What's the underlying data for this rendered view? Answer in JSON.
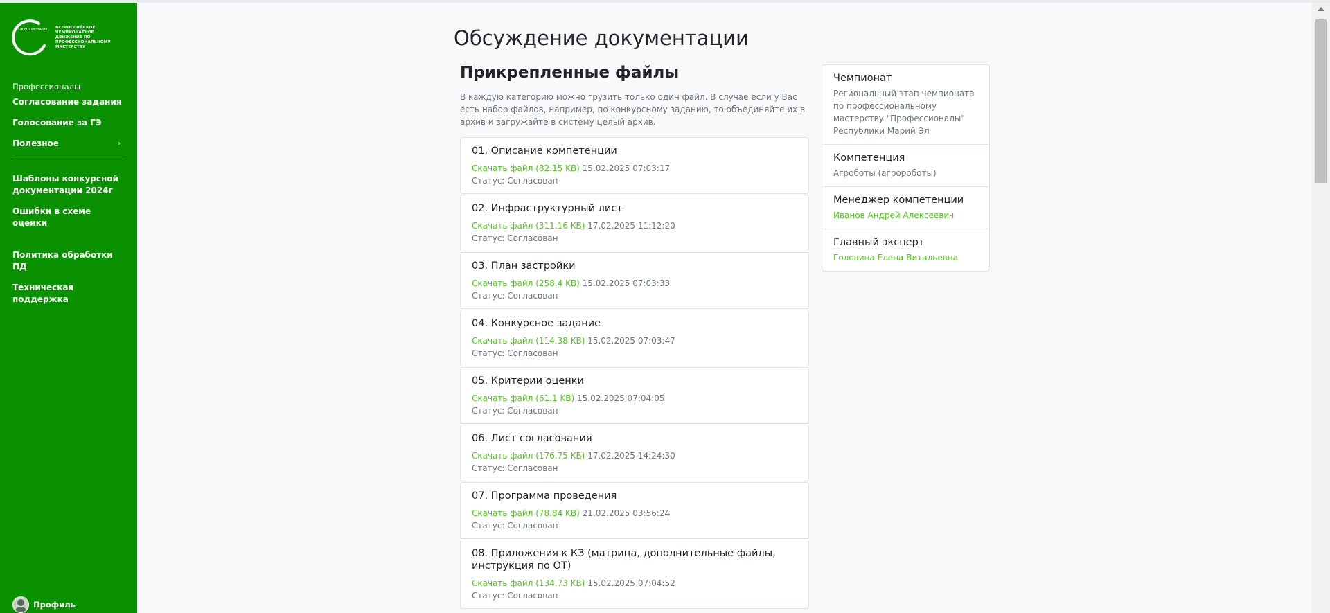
{
  "sidebar": {
    "logo_text": "Всероссийское чемпионатное движение по профессиональному мастерству",
    "logo_ring_text": "ПРОФЕССИОНАЛЫ",
    "section_label": "Профессионалы",
    "items_group1": [
      {
        "label": "Согласование задания"
      },
      {
        "label": "Голосование за ГЭ"
      },
      {
        "label": "Полезное"
      }
    ],
    "items_group2": [
      {
        "label": "Шаблоны конкурсной документации 2024г"
      },
      {
        "label": "Ошибки в схеме оценки"
      }
    ],
    "items_group3": [
      {
        "label": "Политика обработки ПД"
      },
      {
        "label": "Техническая поддержка"
      }
    ],
    "profile_label": "Профиль"
  },
  "main": {
    "page_title": "Обсуждение документации",
    "section_title": "Прикрепленные файлы",
    "hint": "В каждую категорию можно грузить только один файл. В случае если у Вас есть набор файлов, например, по конкурсному заданию, то объединяйте их в архив и загружайте в систему целый архив.",
    "files": [
      {
        "title": "01. Описание компетенции",
        "link": "Скачать файл (82.15 KB)",
        "date": "15.02.2025 07:03:17",
        "status": "Статус: Согласован"
      },
      {
        "title": "02. Инфраструктурный лист",
        "link": "Скачать файл (311.16 KB)",
        "date": "17.02.2025 11:12:20",
        "status": "Статус: Согласован"
      },
      {
        "title": "03. План застройки",
        "link": "Скачать файл (258.4 KB)",
        "date": "15.02.2025 07:03:33",
        "status": "Статус: Согласован"
      },
      {
        "title": "04. Конкурсное задание",
        "link": "Скачать файл (114.38 KB)",
        "date": "15.02.2025 07:03:47",
        "status": "Статус: Согласован"
      },
      {
        "title": "05. Критерии оценки",
        "link": "Скачать файл (61.1 KB)",
        "date": "15.02.2025 07:04:05",
        "status": "Статус: Согласован"
      },
      {
        "title": "06. Лист согласования",
        "link": "Скачать файл (176.75 KB)",
        "date": "17.02.2025 14:24:30",
        "status": "Статус: Согласован"
      },
      {
        "title": "07. Программа проведения",
        "link": "Скачать файл (78.84 KB)",
        "date": "21.02.2025 03:56:24",
        "status": "Статус: Согласован"
      },
      {
        "title": "08. Приложения к КЗ (матрица, дополнительные файлы, инструкция по ОТ)",
        "link": "Скачать файл (134.73 KB)",
        "date": "15.02.2025 07:04:52",
        "status": "Статус: Согласован"
      }
    ]
  },
  "info": {
    "championship_label": "Чемпионат",
    "championship_value": "Региональный этап чемпионата по профессиональному мастерству \"Профессионалы\" Республики Марий Эл",
    "competence_label": "Компетенция",
    "competence_value": "Агроботы (агророботы)",
    "manager_label": "Менеджер компетенции",
    "manager_value": "Иванов Андрей Алексеевич",
    "chief_label": "Главный эксперт",
    "chief_value": "Головина Елена Витальевна"
  },
  "colors": {
    "sidebar_bg": "#0a9100",
    "link": "#52c41a",
    "page_bg": "#f8f9fa"
  }
}
